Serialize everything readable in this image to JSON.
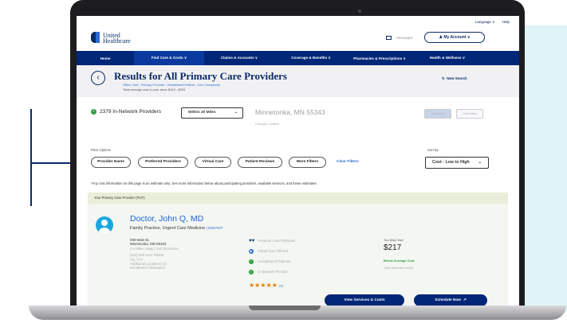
{
  "utility": {
    "language": "Language ∨",
    "help": "Help"
  },
  "brand": {
    "line1": "United",
    "line2": "Healthcare"
  },
  "header": {
    "messages": "Messages",
    "account": "My Account ∨"
  },
  "nav": {
    "items": [
      "Home",
      "Find Care & Costs ∨",
      "Claims & Accounts ∨",
      "Coverage & Benefits ∨",
      "Pharmacies & Prescriptions ∨",
      "Health & Wellness ∨"
    ]
  },
  "page": {
    "title": "Results for All Primary Care Providers",
    "subtitle": "Office Visit - Primary Provider - Established Patient - Low Complexity",
    "avg_cost": "Total average cost in your area: $142 - $203",
    "new_search": "New Search"
  },
  "results": {
    "count": "2379 In-Network Providers",
    "distance": "Within 20 Miles",
    "location": "Minnetonka, MN 55343",
    "change_location": "Change Location",
    "view_list": "View List",
    "view_map": "View Map"
  },
  "filters": {
    "label": "Filter Options",
    "chips": [
      "Provider Name",
      "Preferred Providers",
      "Virtual Care",
      "Patient Reviews",
      "More Filters"
    ],
    "clear": "Clear Filters",
    "sort_label": "Sort By",
    "sort_value": "Cost - Low to High"
  },
  "disclaimer": "*Any cost information on this page is an estimate only. See more information below about participating providers, available services, and these estimates.",
  "provider": {
    "pcp_label": "Your Primary Care Provider (PCP)",
    "name": "Doctor, John Q, MD",
    "specialty": "Family Practice, Urgent Care Medicine",
    "edit_pcp": "Edit PCP",
    "address1": "000 Main St.",
    "address2": "Minnetonka, MN 55343",
    "distance": "4.4 Miles Away | Get Directions",
    "phone": "(111) 000-1111 Phone",
    "tty": "711 TTY",
    "additional_locations": "Additional Locations (4)",
    "enrollment_info": "Enrollment Information",
    "features": [
      "Premium Care Physician",
      "Virtual Care Offered",
      "Accepting All Patients",
      "In-Network Provider"
    ],
    "rating_stars": "★★★★★",
    "review_count": "(9)",
    "you_may_owe_label": "You May Owe",
    "cost": "$217",
    "cost_note": "Below Average Cost",
    "estimate_detail": "View Estimate Detail",
    "services_button": "View Services & Costs",
    "schedule_button": "Schedule Now"
  },
  "icons": {
    "back": "chevron-left-icon",
    "refresh": "refresh-icon",
    "message": "envelope-icon",
    "account": "user-icon",
    "check": "check-circle-icon",
    "external": "external-link-icon"
  }
}
